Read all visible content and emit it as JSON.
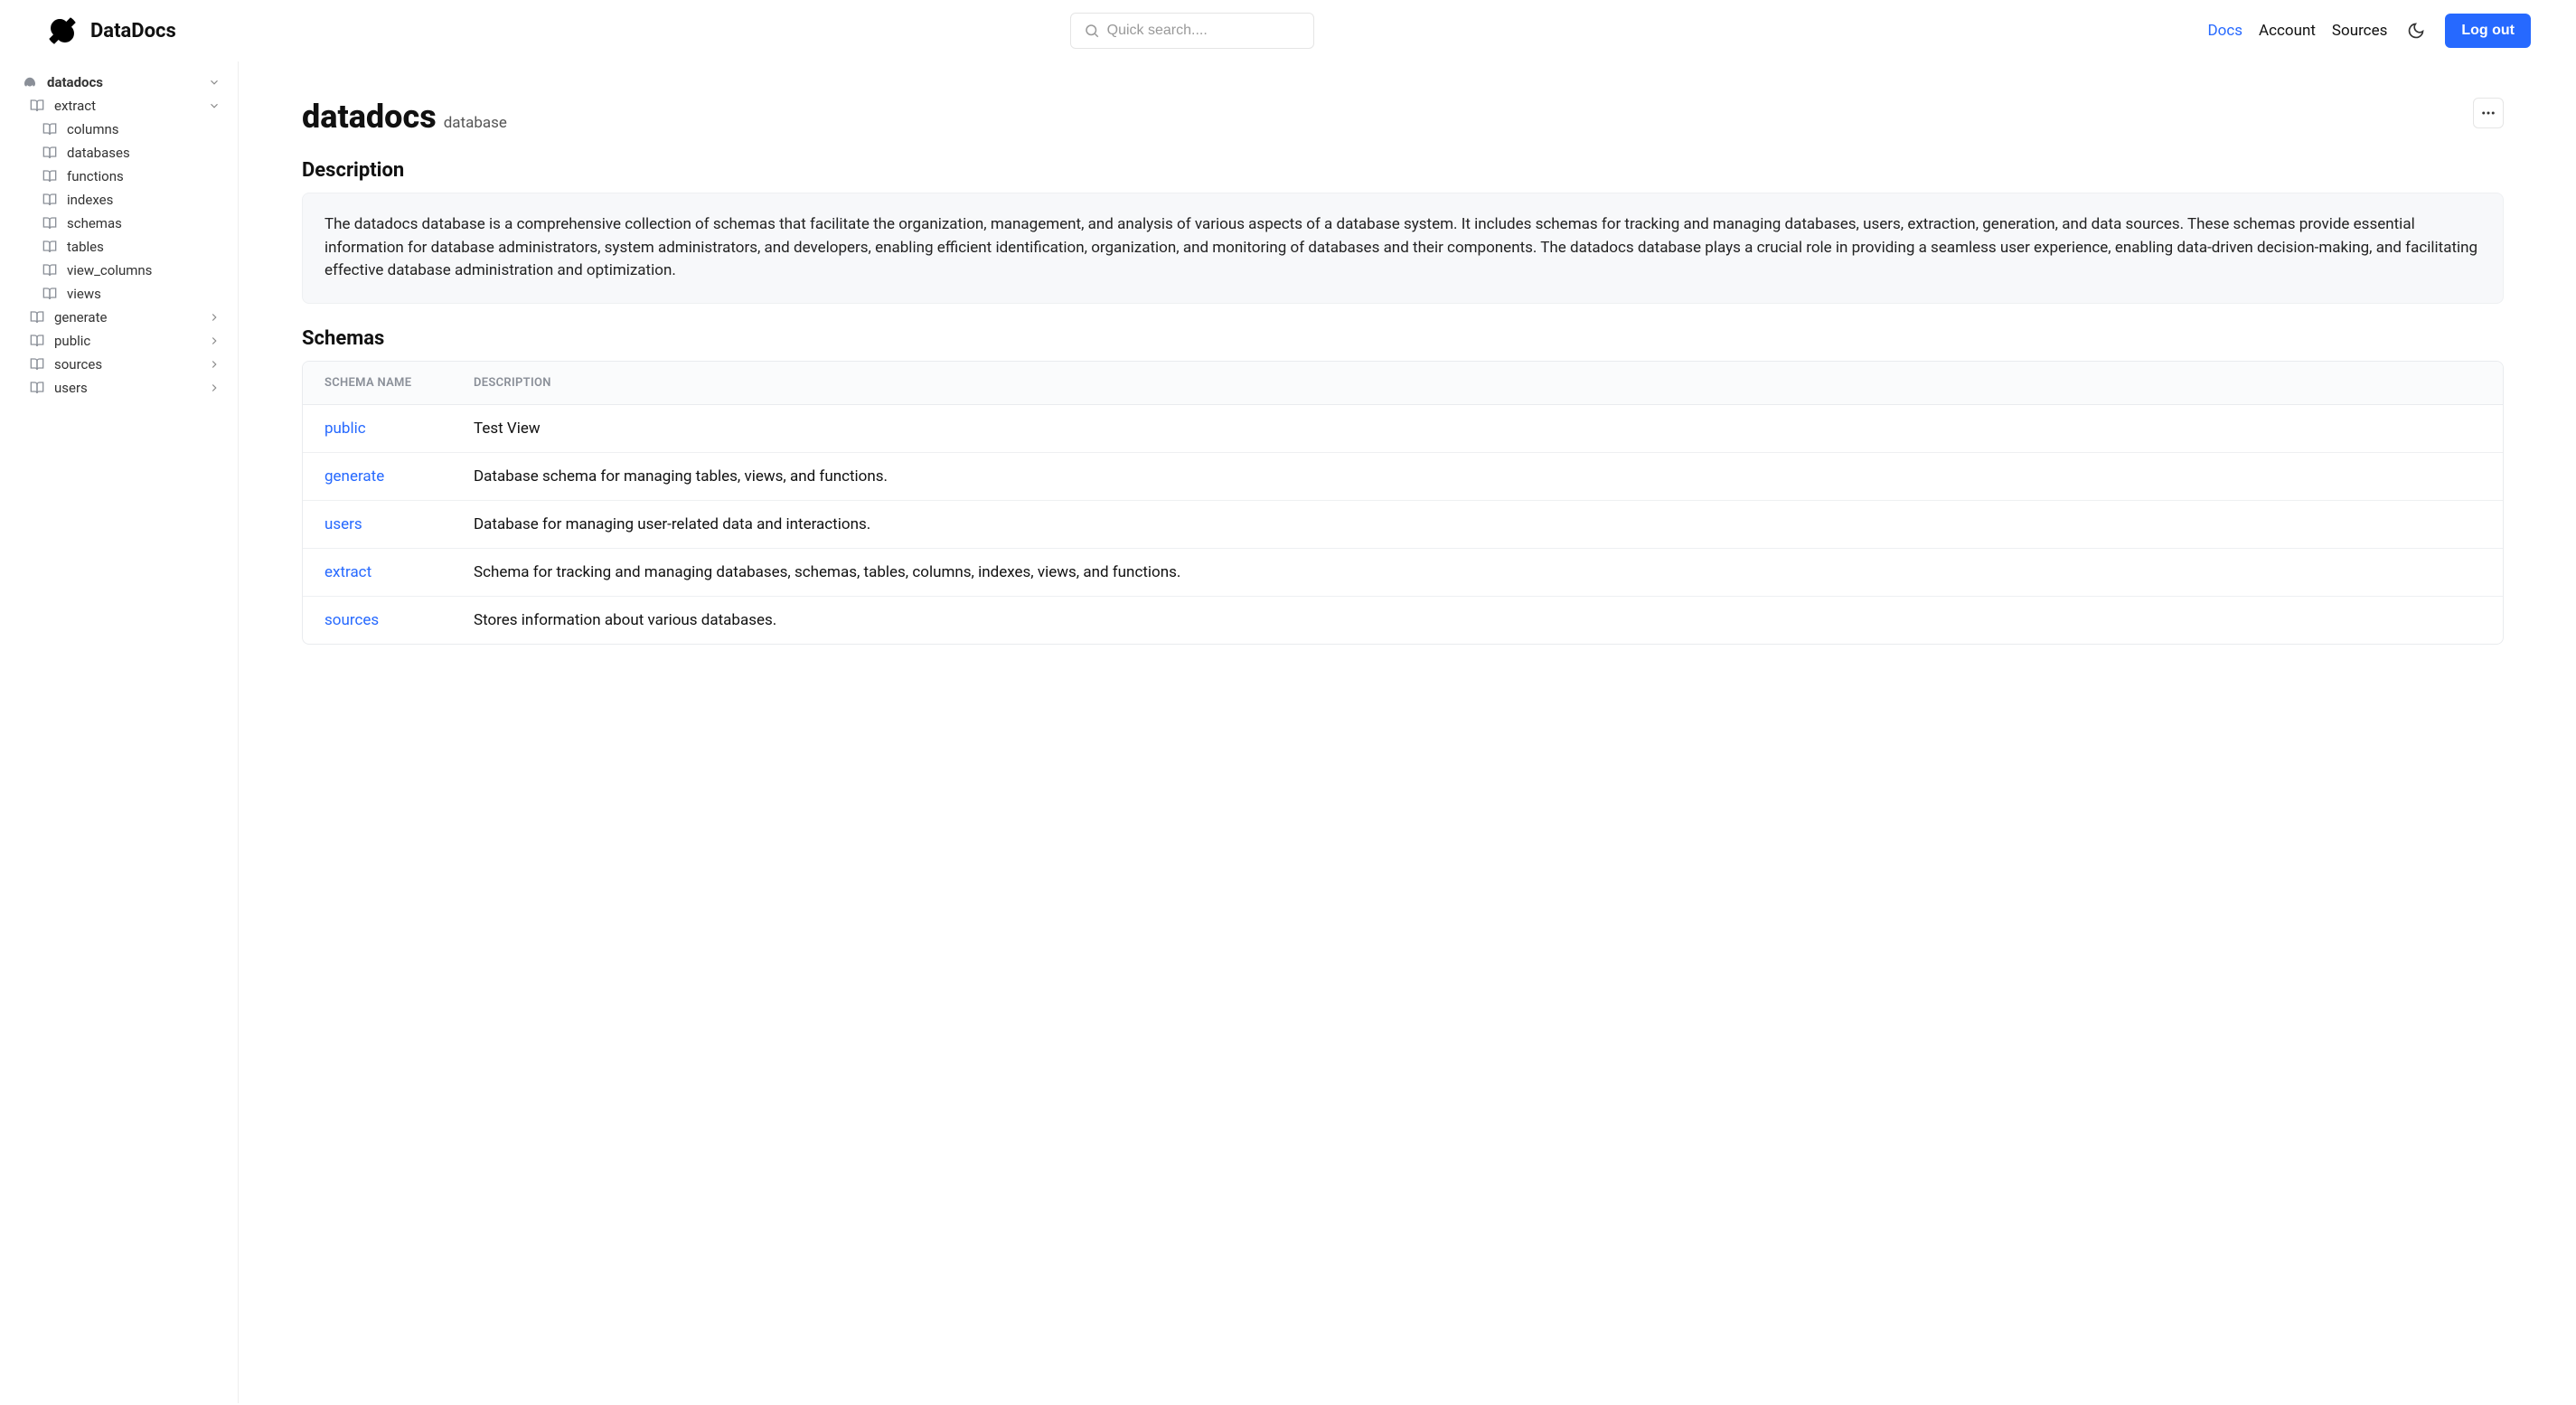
{
  "brand": {
    "name": "DataDocs"
  },
  "search": {
    "placeholder": "Quick search...."
  },
  "nav": {
    "docs": "Docs",
    "account": "Account",
    "sources": "Sources",
    "logout": "Log out"
  },
  "sidebar": {
    "root": {
      "label": "datadocs"
    },
    "items": [
      {
        "label": "extract",
        "expandable": true,
        "expanded": true,
        "children": [
          {
            "label": "columns"
          },
          {
            "label": "databases"
          },
          {
            "label": "functions"
          },
          {
            "label": "indexes"
          },
          {
            "label": "schemas"
          },
          {
            "label": "tables"
          },
          {
            "label": "view_columns"
          },
          {
            "label": "views"
          }
        ]
      },
      {
        "label": "generate",
        "expandable": true,
        "expanded": false
      },
      {
        "label": "public",
        "expandable": true,
        "expanded": false
      },
      {
        "label": "sources",
        "expandable": true,
        "expanded": false
      },
      {
        "label": "users",
        "expandable": true,
        "expanded": false
      }
    ]
  },
  "page": {
    "title": "datadocs",
    "subtitle": "database",
    "description_heading": "Description",
    "description": "The datadocs database is a comprehensive collection of schemas that facilitate the organization, management, and analysis of various aspects of a database system. It includes schemas for tracking and managing databases, users, extraction, generation, and data sources. These schemas provide essential information for database administrators, system administrators, and developers, enabling efficient identification, organization, and monitoring of databases and their components. The datadocs database plays a crucial role in providing a seamless user experience, enabling data-driven decision-making, and facilitating effective database administration and optimization.",
    "schemas_heading": "Schemas",
    "table_headers": {
      "name": "Schema Name",
      "desc": "Description"
    },
    "schemas": [
      {
        "name": "public",
        "desc": "Test View"
      },
      {
        "name": "generate",
        "desc": "Database schema for managing tables, views, and functions."
      },
      {
        "name": "users",
        "desc": "Database for managing user-related data and interactions."
      },
      {
        "name": "extract",
        "desc": "Schema for tracking and managing databases, schemas, tables, columns, indexes, views, and functions."
      },
      {
        "name": "sources",
        "desc": "Stores information about various databases."
      }
    ]
  }
}
